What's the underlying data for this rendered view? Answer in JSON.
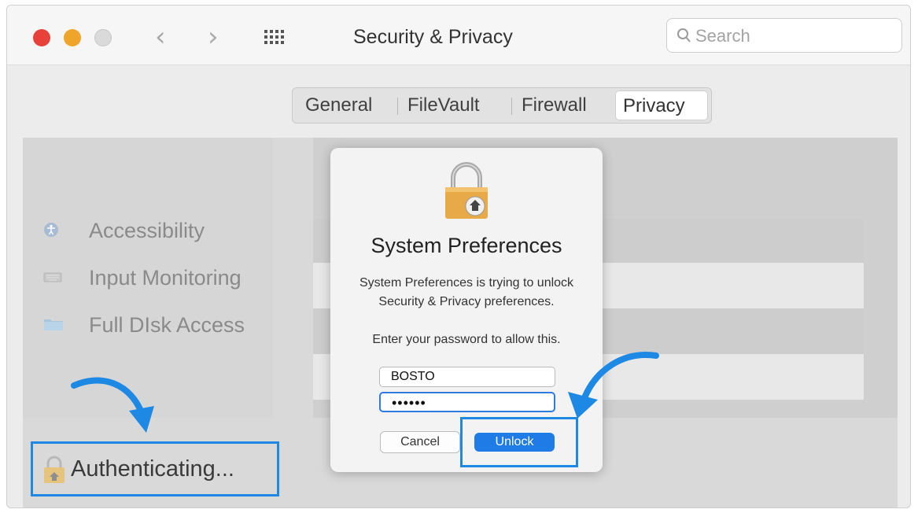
{
  "window": {
    "title": "Security & Privacy",
    "search_placeholder": "Search"
  },
  "tabs": [
    {
      "label": "General"
    },
    {
      "label": "FileVault"
    },
    {
      "label": "Firewall"
    },
    {
      "label": "Privacy",
      "active": true
    }
  ],
  "sidebar": {
    "items": [
      {
        "label": "Accessibility",
        "icon": "accessibility-icon"
      },
      {
        "label": "Input Monitoring",
        "icon": "keyboard-icon"
      },
      {
        "label": "Full DIsk Access",
        "icon": "folder-icon"
      }
    ]
  },
  "auth_status": {
    "label": "Authenticating..."
  },
  "dialog": {
    "title": "System Preferences",
    "message_line1": "System Preferences is trying to unlock",
    "message_line2": "Security & Privacy preferences.",
    "prompt": "Enter your password to allow this.",
    "username_value": "BOSTO",
    "password_value": "••••••",
    "cancel_label": "Cancel",
    "unlock_label": "Unlock"
  },
  "colors": {
    "accent": "#1e88e5",
    "unlock_button": "#1f7be6",
    "close": "#e8413a",
    "minimize": "#efa52a"
  }
}
